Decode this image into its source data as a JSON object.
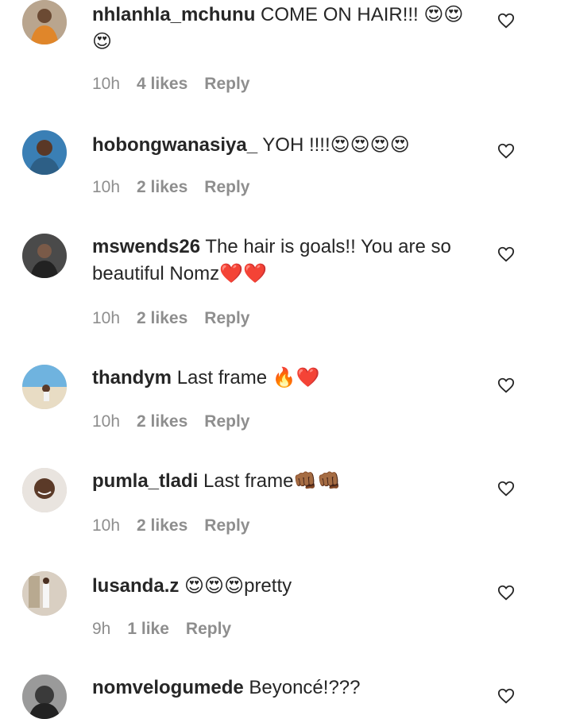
{
  "comments": [
    {
      "username": "nhlanhla_mchunu",
      "text": "COME ON HAIR!!! 😍😍😍",
      "time": "10h",
      "likes": "4 likes",
      "reply": "Reply",
      "avatar_icon": "avatar-man-orange-jacket"
    },
    {
      "username": "hobongwanasiya_",
      "text": "YOH !!!!😍😍😍😍",
      "time": "10h",
      "likes": "2 likes",
      "reply": "Reply",
      "avatar_icon": "avatar-woman-blue"
    },
    {
      "username": "mswends26",
      "text": "The hair is goals!! You are so beautiful Nomz❤️❤️",
      "time": "10h",
      "likes": "2 likes",
      "reply": "Reply",
      "avatar_icon": "avatar-woman-dark"
    },
    {
      "username": "thandym",
      "text": "Last frame 🔥❤️",
      "time": "10h",
      "likes": "2 likes",
      "reply": "Reply",
      "avatar_icon": "avatar-beach"
    },
    {
      "username": "pumla_tladi",
      "text": "Last frame👊🏾👊🏾",
      "time": "10h",
      "likes": "2 likes",
      "reply": "Reply",
      "avatar_icon": "avatar-woman-smile"
    },
    {
      "username": "lusanda.z",
      "text": "😍😍😍pretty",
      "time": "9h",
      "likes": "1 like",
      "reply": "Reply",
      "avatar_icon": "avatar-room"
    },
    {
      "username": "nomvelogumede",
      "text": "Beyoncé!???",
      "time": "",
      "likes": "",
      "reply": "",
      "avatar_icon": "avatar-woman-bw"
    }
  ],
  "colors": {
    "text": "#262626",
    "meta": "#8e8e8e",
    "background": "#ffffff"
  },
  "icons": {
    "like": "heart-outline-icon"
  }
}
